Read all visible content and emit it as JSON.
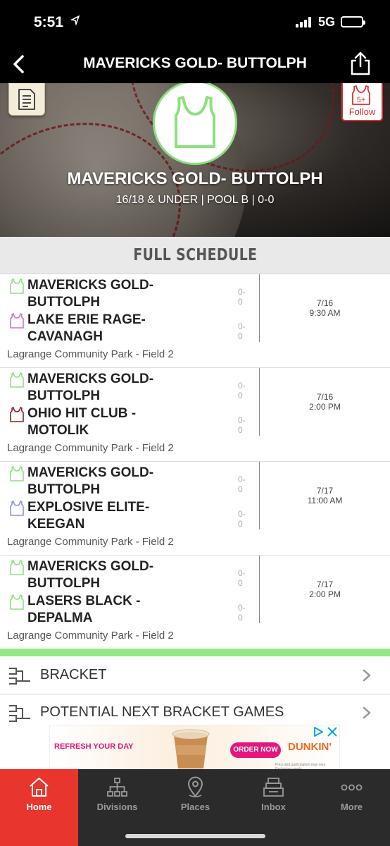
{
  "status_bar": {
    "time": "5:51",
    "network": "5G"
  },
  "nav": {
    "title": "MAVERICKS GOLD- BUTTOLPH"
  },
  "hero": {
    "team_name": "MAVERICKS GOLD- BUTTOLPH",
    "subtitle": "16/18 & UNDER | POOL B | 0-0",
    "follow_label": "Follow",
    "follow_badge": "5+"
  },
  "schedule": {
    "header": "FULL SCHEDULE",
    "games": [
      {
        "home": {
          "name": "MAVERICKS GOLD- BUTTOLPH",
          "score": "0-0",
          "color": "#8de07f"
        },
        "away": {
          "name": "LAKE ERIE RAGE- CAVANAGH",
          "score": "0-0",
          "color": "#d96ad9"
        },
        "date": "7/16",
        "time": "9:30 AM",
        "venue": "Lagrange Community Park - Field 2"
      },
      {
        "home": {
          "name": "MAVERICKS GOLD- BUTTOLPH",
          "score": "0-0",
          "color": "#8de07f"
        },
        "away": {
          "name": "OHIO HIT CLUB -MOTOLIK",
          "score": "0-0",
          "color": "#8b2020"
        },
        "date": "7/16",
        "time": "2:00 PM",
        "venue": "Lagrange Community Park - Field 2"
      },
      {
        "home": {
          "name": "MAVERICKS GOLD- BUTTOLPH",
          "score": "0-0",
          "color": "#8de07f"
        },
        "away": {
          "name": "EXPLOSIVE ELITE- KEEGAN",
          "score": "0-0",
          "color": "#8b8fe6"
        },
        "date": "7/17",
        "time": "11:00 AM",
        "venue": "Lagrange Community Park - Field 2"
      },
      {
        "home": {
          "name": "MAVERICKS GOLD- BUTTOLPH",
          "score": "0-0",
          "color": "#8de07f"
        },
        "away": {
          "name": "LASERS BLACK -DEPALMA",
          "score": "0-0",
          "color": "#8de07f"
        },
        "date": "7/17",
        "time": "2:00 PM",
        "venue": "Lagrange Community Park - Field 2"
      }
    ]
  },
  "links": [
    {
      "label": "BRACKET",
      "icon": "bracket-icon"
    },
    {
      "label": "POTENTIAL NEXT BRACKET GAMES",
      "icon": "bracket-icon"
    }
  ],
  "ad": {
    "tagline": "REFRESH YOUR DAY",
    "cta": "ORDER NOW",
    "brand": "DUNKIN'",
    "fine_print": "Price and participation may vary. Exclusions apply."
  },
  "tabs": [
    {
      "label": "Home",
      "icon": "home-icon",
      "active": true
    },
    {
      "label": "Divisions",
      "icon": "divisions-icon",
      "active": false
    },
    {
      "label": "Places",
      "icon": "places-icon",
      "active": false
    },
    {
      "label": "Inbox",
      "icon": "inbox-icon",
      "active": false
    },
    {
      "label": "More",
      "icon": "more-icon",
      "active": false
    }
  ],
  "colors": {
    "accent": "#e8352d",
    "team": "#8de07f",
    "tabbar": "#2b2b2b"
  }
}
